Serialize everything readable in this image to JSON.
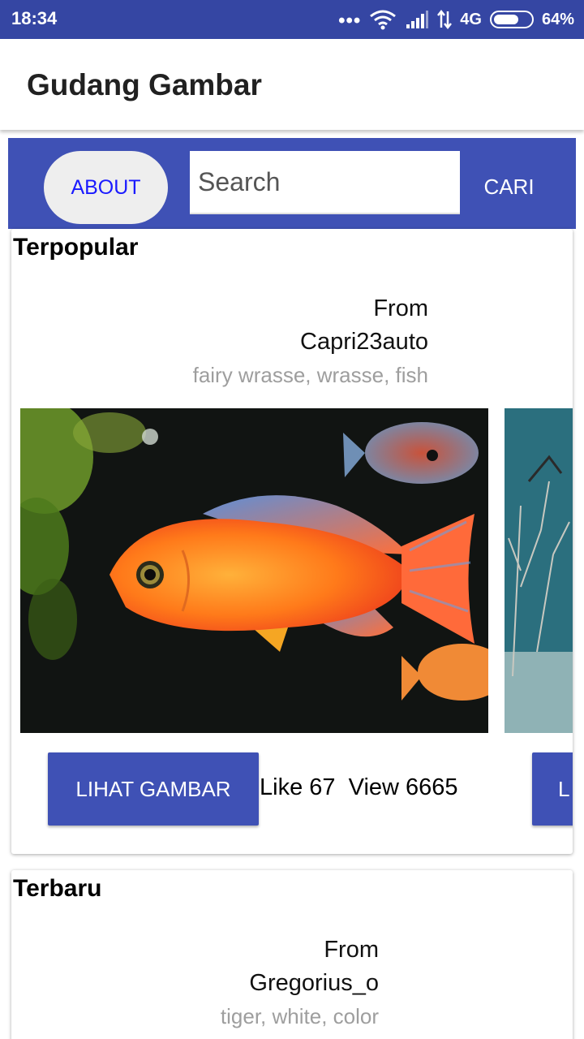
{
  "status_bar": {
    "time": "18:34",
    "network": "4G",
    "battery": "64%",
    "icons": [
      "more-dots-icon",
      "wifi-icon",
      "signal-icon",
      "data-arrows-icon",
      "battery-icon"
    ]
  },
  "app_bar": {
    "title": "Gudang Gambar"
  },
  "search_bar": {
    "about_label": "ABOUT",
    "search_placeholder": "Search",
    "search_value": "",
    "cari_label": "CARI"
  },
  "colors": {
    "primary": "#3f51b5",
    "status_bar": "#3546a3",
    "about_text": "#1a1aff",
    "tags_text": "#9e9e9e"
  },
  "sections": [
    {
      "title": "Terpopular",
      "item": {
        "from_label": "From",
        "author": "Capri23auto",
        "tags": "fairy wrasse, wrasse, fish",
        "button_label": "LIHAT GAMBAR",
        "stats": "Like 67  View 6665",
        "next_button_label": "L"
      }
    },
    {
      "title": "Terbaru",
      "item": {
        "from_label": "From",
        "author": "Gregorius_o",
        "tags": "tiger, white, color"
      }
    }
  ]
}
